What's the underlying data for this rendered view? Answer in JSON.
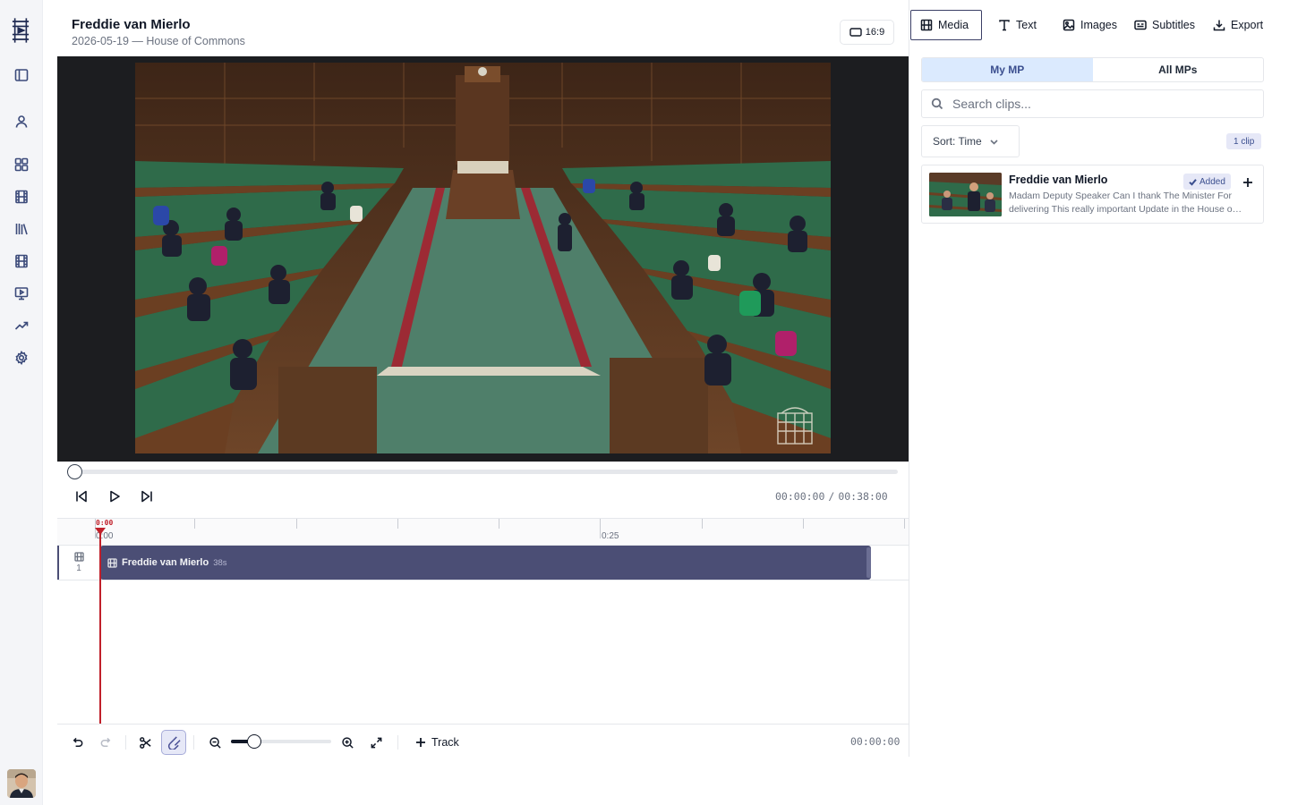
{
  "project": {
    "title": "Freddie van Mierlo",
    "subtitle": "2026-05-19 — House of Commons",
    "aspect_ratio": "16:9"
  },
  "rail": {
    "icons": [
      "logo-filmstrip-icon",
      "sidebar-toggle-icon",
      "user-icon",
      "dashboard-icon",
      "film-icon",
      "library-icon",
      "filmstrip-icon",
      "monitor-play-icon",
      "trending-icon",
      "settings-icon"
    ]
  },
  "player": {
    "current_time": "00:00:00",
    "duration": "00:38:00",
    "progress": 0
  },
  "timeline": {
    "playhead_label": "0:00",
    "tick_labels": [
      "0:00",
      "0:25"
    ],
    "track_number": "1",
    "clip": {
      "name": "Freddie van Mierlo",
      "duration": "38s"
    },
    "time": "00:00:00",
    "track_button_label": "Track",
    "zoom_level": 0.23
  },
  "panel": {
    "tabs": [
      {
        "label": "Media",
        "icon": "film-icon",
        "active": true
      },
      {
        "label": "Text",
        "icon": "text-icon"
      },
      {
        "label": "Images",
        "icon": "image-icon"
      },
      {
        "label": "Subtitles",
        "icon": "subtitles-icon"
      },
      {
        "label": "Export",
        "icon": "download-icon"
      }
    ],
    "segments": [
      "My MP",
      "All MPs"
    ],
    "active_segment": "My MP",
    "search_placeholder": "Search clips...",
    "sort_label": "Sort: Time",
    "clip_count": "1 clip",
    "clips": [
      {
        "name": "Freddie van Mierlo",
        "status": "Added",
        "excerpt": "Madam Deputy Speaker Can I thank The Minister For delivering This really important Update in the House of Commons today"
      }
    ]
  },
  "colors": {
    "accent": "#4b4e75",
    "playhead": "#c0202a",
    "segment_active_bg": "#dbeafe",
    "bench_green": "#2f6b4a"
  }
}
